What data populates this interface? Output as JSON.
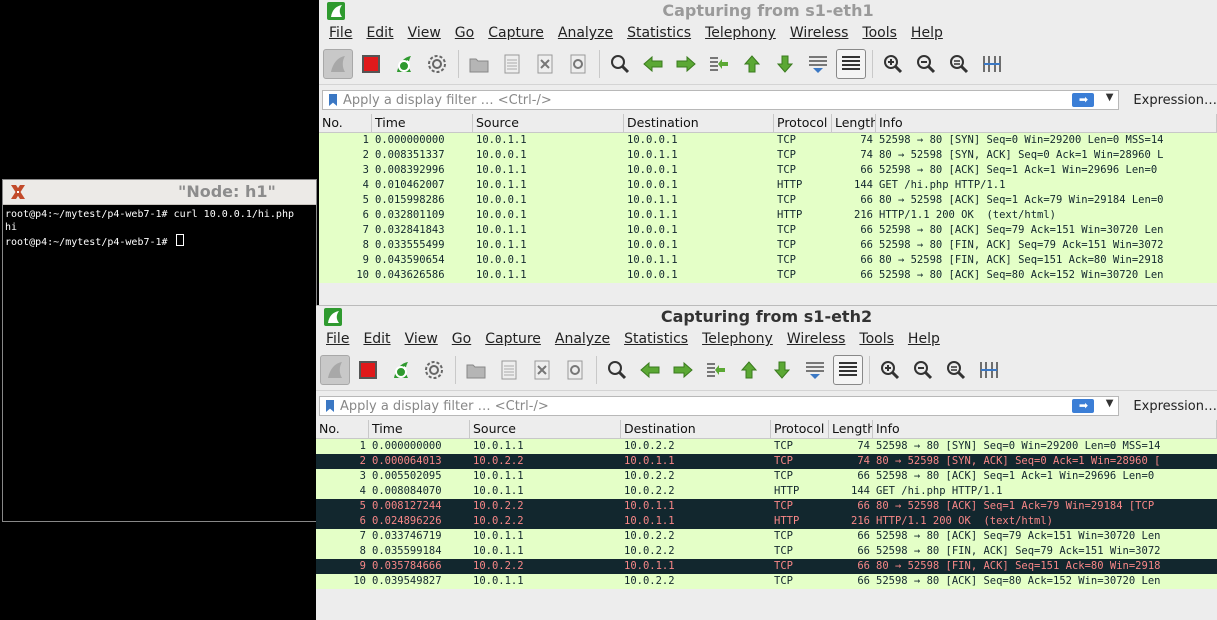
{
  "terminal": {
    "title": "\"Node: h1\"",
    "lines": [
      "root@p4:~/mytest/p4-web7-1# curl 10.0.0.1/hi.php",
      "hi",
      "root@p4:~/mytest/p4-web7-1# "
    ]
  },
  "wireshark1": {
    "title": "Capturing from s1-eth1",
    "menu": [
      "File",
      "Edit",
      "View",
      "Go",
      "Capture",
      "Analyze",
      "Statistics",
      "Telephony",
      "Wireless",
      "Tools",
      "Help"
    ],
    "filter_placeholder": "Apply a display filter … <Ctrl-/>",
    "expression_label": "Expression…",
    "columns": [
      "No.",
      "Time",
      "Source",
      "Destination",
      "Protocol",
      "Length",
      "Info"
    ],
    "packets": [
      {
        "no": "1",
        "time": "0.000000000",
        "src": "10.0.1.1",
        "dst": "10.0.0.1",
        "proto": "TCP",
        "len": "74",
        "info": "52598 → 80 [SYN] Seq=0 Win=29200 Len=0 MSS=14",
        "style": "tcp"
      },
      {
        "no": "2",
        "time": "0.008351337",
        "src": "10.0.0.1",
        "dst": "10.0.1.1",
        "proto": "TCP",
        "len": "74",
        "info": "80 → 52598 [SYN, ACK] Seq=0 Ack=1 Win=28960 L",
        "style": "tcp"
      },
      {
        "no": "3",
        "time": "0.008392996",
        "src": "10.0.1.1",
        "dst": "10.0.0.1",
        "proto": "TCP",
        "len": "66",
        "info": "52598 → 80 [ACK] Seq=1 Ack=1 Win=29696 Len=0",
        "style": "tcp"
      },
      {
        "no": "4",
        "time": "0.010462007",
        "src": "10.0.1.1",
        "dst": "10.0.0.1",
        "proto": "HTTP",
        "len": "144",
        "info": "GET /hi.php HTTP/1.1",
        "style": "http"
      },
      {
        "no": "5",
        "time": "0.015998286",
        "src": "10.0.0.1",
        "dst": "10.0.1.1",
        "proto": "TCP",
        "len": "66",
        "info": "80 → 52598 [ACK] Seq=1 Ack=79 Win=29184 Len=0",
        "style": "tcp"
      },
      {
        "no": "6",
        "time": "0.032801109",
        "src": "10.0.0.1",
        "dst": "10.0.1.1",
        "proto": "HTTP",
        "len": "216",
        "info": "HTTP/1.1 200 OK  (text/html)",
        "style": "http"
      },
      {
        "no": "7",
        "time": "0.032841843",
        "src": "10.0.1.1",
        "dst": "10.0.0.1",
        "proto": "TCP",
        "len": "66",
        "info": "52598 → 80 [ACK] Seq=79 Ack=151 Win=30720 Len",
        "style": "tcp"
      },
      {
        "no": "8",
        "time": "0.033555499",
        "src": "10.0.1.1",
        "dst": "10.0.0.1",
        "proto": "TCP",
        "len": "66",
        "info": "52598 → 80 [FIN, ACK] Seq=79 Ack=151 Win=3072",
        "style": "tcp"
      },
      {
        "no": "9",
        "time": "0.043590654",
        "src": "10.0.0.1",
        "dst": "10.0.1.1",
        "proto": "TCP",
        "len": "66",
        "info": "80 → 52598 [FIN, ACK] Seq=151 Ack=80 Win=2918",
        "style": "tcp"
      },
      {
        "no": "10",
        "time": "0.043626586",
        "src": "10.0.1.1",
        "dst": "10.0.0.1",
        "proto": "TCP",
        "len": "66",
        "info": "52598 → 80 [ACK] Seq=80 Ack=152 Win=30720 Len",
        "style": "tcp"
      }
    ]
  },
  "wireshark2": {
    "title": "Capturing from s1-eth2",
    "menu": [
      "File",
      "Edit",
      "View",
      "Go",
      "Capture",
      "Analyze",
      "Statistics",
      "Telephony",
      "Wireless",
      "Tools",
      "Help"
    ],
    "filter_placeholder": "Apply a display filter … <Ctrl-/>",
    "expression_label": "Expression…",
    "columns": [
      "No.",
      "Time",
      "Source",
      "Destination",
      "Protocol",
      "Length",
      "Info"
    ],
    "packets": [
      {
        "no": "1",
        "time": "0.000000000",
        "src": "10.0.1.1",
        "dst": "10.0.2.2",
        "proto": "TCP",
        "len": "74",
        "info": "52598 → 80 [SYN] Seq=0 Win=29200 Len=0 MSS=14",
        "style": "tcp"
      },
      {
        "no": "2",
        "time": "0.000064013",
        "src": "10.0.2.2",
        "dst": "10.0.1.1",
        "proto": "TCP",
        "len": "74",
        "info": "80 → 52598 [SYN, ACK] Seq=0 Ack=1 Win=28960 [",
        "style": "bad"
      },
      {
        "no": "3",
        "time": "0.005502095",
        "src": "10.0.1.1",
        "dst": "10.0.2.2",
        "proto": "TCP",
        "len": "66",
        "info": "52598 → 80 [ACK] Seq=1 Ack=1 Win=29696 Len=0",
        "style": "tcp"
      },
      {
        "no": "4",
        "time": "0.008084070",
        "src": "10.0.1.1",
        "dst": "10.0.2.2",
        "proto": "HTTP",
        "len": "144",
        "info": "GET /hi.php HTTP/1.1",
        "style": "http"
      },
      {
        "no": "5",
        "time": "0.008127244",
        "src": "10.0.2.2",
        "dst": "10.0.1.1",
        "proto": "TCP",
        "len": "66",
        "info": "80 → 52598 [ACK] Seq=1 Ack=79 Win=29184 [TCP",
        "style": "bad"
      },
      {
        "no": "6",
        "time": "0.024896226",
        "src": "10.0.2.2",
        "dst": "10.0.1.1",
        "proto": "HTTP",
        "len": "216",
        "info": "HTTP/1.1 200 OK  (text/html)",
        "style": "bad"
      },
      {
        "no": "7",
        "time": "0.033746719",
        "src": "10.0.1.1",
        "dst": "10.0.2.2",
        "proto": "TCP",
        "len": "66",
        "info": "52598 → 80 [ACK] Seq=79 Ack=151 Win=30720 Len",
        "style": "tcp"
      },
      {
        "no": "8",
        "time": "0.035599184",
        "src": "10.0.1.1",
        "dst": "10.0.2.2",
        "proto": "TCP",
        "len": "66",
        "info": "52598 → 80 [FIN, ACK] Seq=79 Ack=151 Win=3072",
        "style": "tcp"
      },
      {
        "no": "9",
        "time": "0.035784666",
        "src": "10.0.2.2",
        "dst": "10.0.1.1",
        "proto": "TCP",
        "len": "66",
        "info": "80 → 52598 [FIN, ACK] Seq=151 Ack=80 Win=2918",
        "style": "bad"
      },
      {
        "no": "10",
        "time": "0.039549827",
        "src": "10.0.1.1",
        "dst": "10.0.2.2",
        "proto": "TCP",
        "len": "66",
        "info": "52598 → 80 [ACK] Seq=80 Ack=152 Win=30720 Len",
        "style": "tcp"
      }
    ]
  },
  "colors": {
    "row_tcp_bg": "#e4ffc7",
    "row_bad_bg": "#12272e",
    "row_bad_fg": "#f78787",
    "stop_red": "#e0191b",
    "shark_green": "#2f9a2f"
  }
}
